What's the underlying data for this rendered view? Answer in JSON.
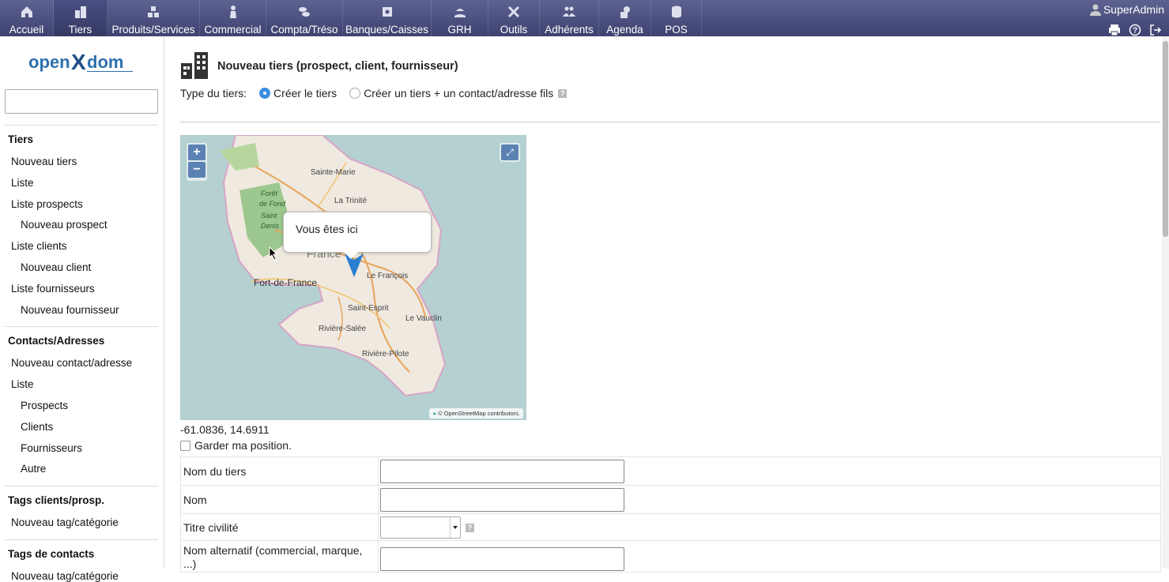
{
  "topbar": {
    "menu": [
      {
        "label": "Accueil",
        "icon": "home-icon"
      },
      {
        "label": "Tiers",
        "icon": "building-icon",
        "active": true
      },
      {
        "label": "Produits/Services",
        "icon": "boxes-icon"
      },
      {
        "label": "Commercial",
        "icon": "person-icon"
      },
      {
        "label": "Compta/Tréso",
        "icon": "coins-icon"
      },
      {
        "label": "Banques/Caisses",
        "icon": "safe-icon"
      },
      {
        "label": "GRH",
        "icon": "beach-icon"
      },
      {
        "label": "Outils",
        "icon": "tools-icon"
      },
      {
        "label": "Adhérents",
        "icon": "group-icon"
      },
      {
        "label": "Agenda",
        "icon": "agenda-icon"
      },
      {
        "label": "POS",
        "icon": "database-icon"
      }
    ],
    "user": "SuperAdmin"
  },
  "sidebar": {
    "sections": [
      {
        "title": "Tiers",
        "links": [
          {
            "label": "Nouveau tiers",
            "sub": false
          },
          {
            "label": "Liste",
            "sub": false
          },
          {
            "label": "Liste prospects",
            "sub": false
          },
          {
            "label": "Nouveau prospect",
            "sub": true
          },
          {
            "label": "Liste clients",
            "sub": false
          },
          {
            "label": "Nouveau client",
            "sub": true
          },
          {
            "label": "Liste fournisseurs",
            "sub": false
          },
          {
            "label": "Nouveau fournisseur",
            "sub": true
          }
        ]
      },
      {
        "title": "Contacts/Adresses",
        "links": [
          {
            "label": "Nouveau contact/adresse",
            "sub": false
          },
          {
            "label": "Liste",
            "sub": false
          },
          {
            "label": "Prospects",
            "sub": true
          },
          {
            "label": "Clients",
            "sub": true
          },
          {
            "label": "Fournisseurs",
            "sub": true
          },
          {
            "label": "Autre",
            "sub": true
          }
        ]
      },
      {
        "title": "Tags clients/prosp.",
        "links": [
          {
            "label": "Nouveau tag/catégorie",
            "sub": false
          }
        ]
      },
      {
        "title": "Tags de contacts",
        "links": [
          {
            "label": "Nouveau tag/catégorie",
            "sub": false
          }
        ]
      }
    ]
  },
  "main": {
    "title": "Nouveau tiers (prospect, client, fournisseur)",
    "type_label": "Type du tiers:",
    "type_options": [
      "Créer le tiers",
      "Créer un tiers + un contact/adresse fils"
    ],
    "map": {
      "popup": "Vous êtes ici",
      "attribution": "© OpenStreetMap contributors.",
      "places": [
        "Sainte-Marie",
        "La Trinité",
        "Forêt",
        "de Fond",
        "Saint",
        "Denis",
        "France",
        "Fort-de-France",
        "Le François",
        "Saint-Esprit",
        "Le Vauclin",
        "Rivière-Salée",
        "Rivière-Pilote"
      ]
    },
    "coords": "-61.0836, 14.6911",
    "keep_position": "Garder ma position.",
    "fields": [
      {
        "label": "Nom du tiers",
        "type": "text"
      },
      {
        "label": "Nom",
        "type": "text"
      },
      {
        "label": "Titre civilité",
        "type": "select"
      },
      {
        "label": "Nom alternatif (commercial, marque, ...)",
        "type": "text"
      }
    ]
  }
}
